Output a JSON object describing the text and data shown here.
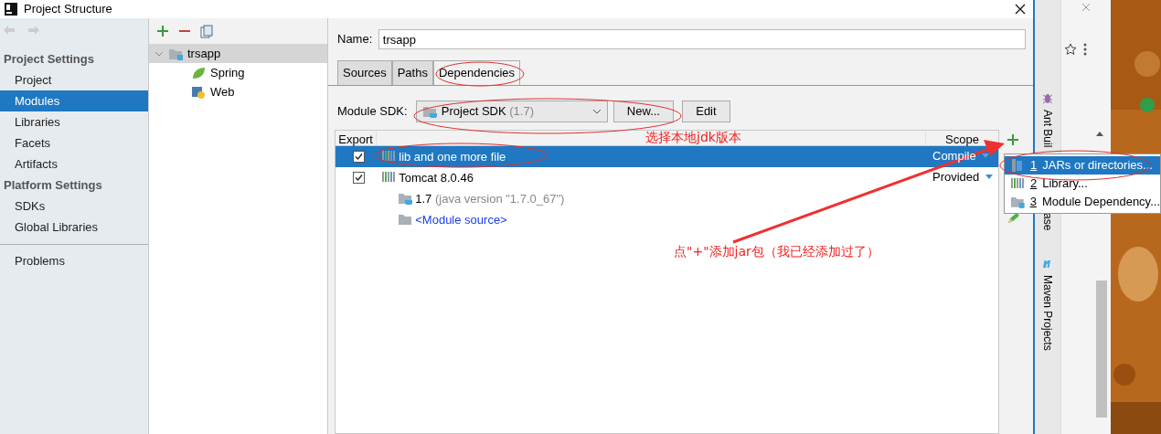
{
  "window": {
    "title": "Project Structure"
  },
  "sidebar": {
    "sections": [
      {
        "heading": "Project Settings",
        "items": [
          {
            "label": "Project",
            "selected": false
          },
          {
            "label": "Modules",
            "selected": true
          },
          {
            "label": "Libraries",
            "selected": false
          },
          {
            "label": "Facets",
            "selected": false
          },
          {
            "label": "Artifacts",
            "selected": false
          }
        ]
      },
      {
        "heading": "Platform Settings",
        "items": [
          {
            "label": "SDKs",
            "selected": false
          },
          {
            "label": "Global Libraries",
            "selected": false
          }
        ]
      }
    ],
    "footer_items": [
      {
        "label": "Problems",
        "selected": false
      }
    ]
  },
  "module_tree": [
    {
      "label": "trsapp",
      "kind": "module",
      "selected": true,
      "expanded": true,
      "children": [
        {
          "label": "Spring",
          "kind": "spring",
          "selected": false
        },
        {
          "label": "Web",
          "kind": "web",
          "selected": false
        }
      ]
    }
  ],
  "name_field": {
    "label": "Name:",
    "value": "trsapp"
  },
  "tabs": [
    {
      "label": "Sources",
      "selected": false
    },
    {
      "label": "Paths",
      "selected": false
    },
    {
      "label": "Dependencies",
      "selected": true
    }
  ],
  "module_sdk": {
    "label": "Module SDK:",
    "value": "Project SDK",
    "version": "(1.7)"
  },
  "sdk_buttons": [
    "New...",
    "Edit"
  ],
  "dependencies": {
    "columns": [
      "Export",
      "Scope"
    ],
    "rows": [
      {
        "kind": "library",
        "checked": true,
        "selected": true,
        "name": "lib and one more file",
        "scope": "Compile"
      },
      {
        "kind": "library",
        "checked": true,
        "selected": false,
        "name": "Tomcat 8.0.46",
        "scope": "Provided"
      },
      {
        "kind": "sdk",
        "selected": false,
        "name": "1.7",
        "detail": "(java version \"1.7.0_67\")"
      },
      {
        "kind": "source",
        "selected": false,
        "name": "<Module source>"
      }
    ]
  },
  "add_menu": [
    {
      "key": "1",
      "label": "JARs or directories...",
      "kind": "jar",
      "selected": true
    },
    {
      "key": "2",
      "label": "Library...",
      "kind": "library",
      "selected": false
    },
    {
      "key": "3",
      "label": "Module Dependency...",
      "kind": "module",
      "selected": false
    }
  ],
  "tool_windows": [
    {
      "label": "Ant Buil",
      "kind": "ant"
    },
    {
      "label": "ase",
      "kind": "plain"
    },
    {
      "label": "Maven Projects",
      "kind": "maven"
    }
  ],
  "annotations": [
    {
      "text": "选择本地jdk版本"
    },
    {
      "text": "点\"+\"添加jar包（我已经添加过了）"
    }
  ]
}
